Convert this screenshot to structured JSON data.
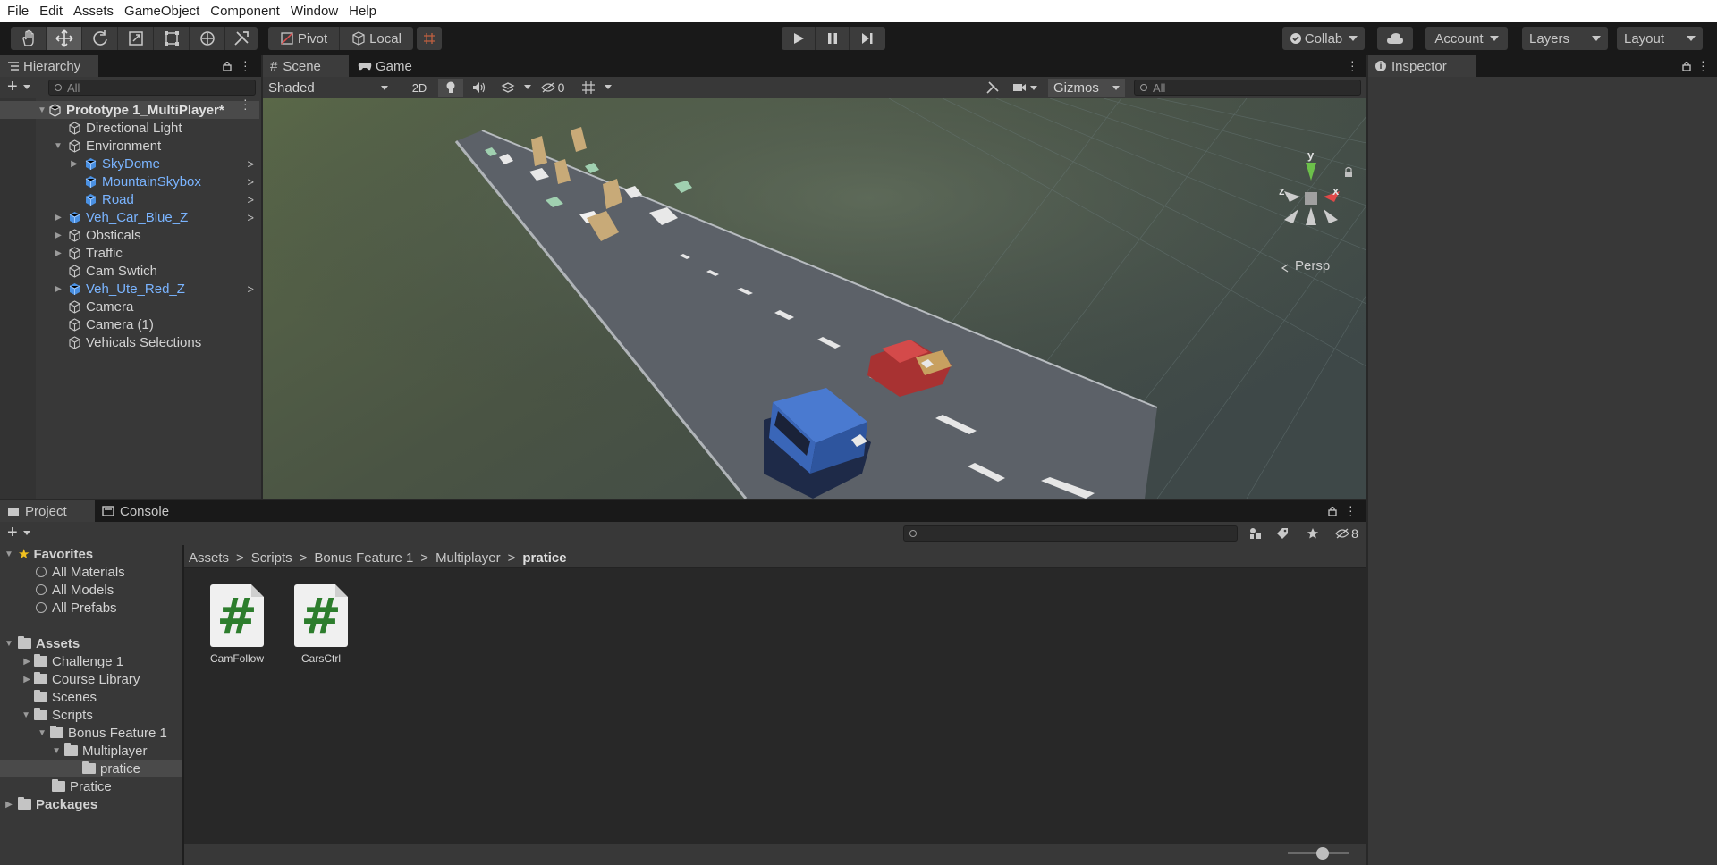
{
  "menu": [
    "File",
    "Edit",
    "Assets",
    "GameObject",
    "Component",
    "Window",
    "Help"
  ],
  "toolbar": {
    "pivot_label": "Pivot",
    "local_label": "Local",
    "collab_label": "Collab",
    "account_label": "Account",
    "layers_label": "Layers",
    "layout_label": "Layout"
  },
  "hierarchy": {
    "tab_label": "Hierarchy",
    "search_placeholder": "All",
    "scene_name": "Prototype 1_MultiPlayer*",
    "items": [
      {
        "label": "Directional Light",
        "prefab": false
      },
      {
        "label": "Environment",
        "prefab": false
      },
      {
        "label": "SkyDome",
        "prefab": true
      },
      {
        "label": "MountainSkybox",
        "prefab": true
      },
      {
        "label": "Road",
        "prefab": true
      },
      {
        "label": "Veh_Car_Blue_Z",
        "prefab": true
      },
      {
        "label": "Obsticals",
        "prefab": false
      },
      {
        "label": "Traffic",
        "prefab": false
      },
      {
        "label": "Cam Swtich",
        "prefab": false
      },
      {
        "label": "Veh_Ute_Red_Z",
        "prefab": true
      },
      {
        "label": "Camera",
        "prefab": false
      },
      {
        "label": "Camera (1)",
        "prefab": false
      },
      {
        "label": "Vehicals Selections",
        "prefab": false
      }
    ]
  },
  "scene": {
    "tab_scene": "Scene",
    "tab_game": "Game",
    "shading_mode": "Shaded",
    "mode_2d": "2D",
    "hidden_count": "0",
    "gizmos_label": "Gizmos",
    "search_placeholder": "All",
    "projection_label": "Persp",
    "axis_x": "x",
    "axis_y": "y",
    "axis_z": "z"
  },
  "inspector": {
    "tab_label": "Inspector"
  },
  "project": {
    "tab_project": "Project",
    "tab_console": "Console",
    "hidden_count": "8",
    "favorites_label": "Favorites",
    "favorites": [
      "All Materials",
      "All Models",
      "All Prefabs"
    ],
    "assets_label": "Assets",
    "tree": [
      {
        "label": "Challenge 1"
      },
      {
        "label": "Course Library"
      },
      {
        "label": "Scenes"
      },
      {
        "label": "Scripts"
      },
      {
        "label": "Bonus Feature 1"
      },
      {
        "label": "Multiplayer"
      },
      {
        "label": "pratice"
      },
      {
        "label": "Pratice"
      }
    ],
    "packages_label": "Packages",
    "breadcrumb": [
      "Assets",
      "Scripts",
      "Bonus Feature 1",
      "Multiplayer",
      "pratice"
    ],
    "files": [
      {
        "name": "CamFollow",
        "glyph": "#"
      },
      {
        "name": "CarsCtrl",
        "glyph": "#"
      }
    ]
  }
}
